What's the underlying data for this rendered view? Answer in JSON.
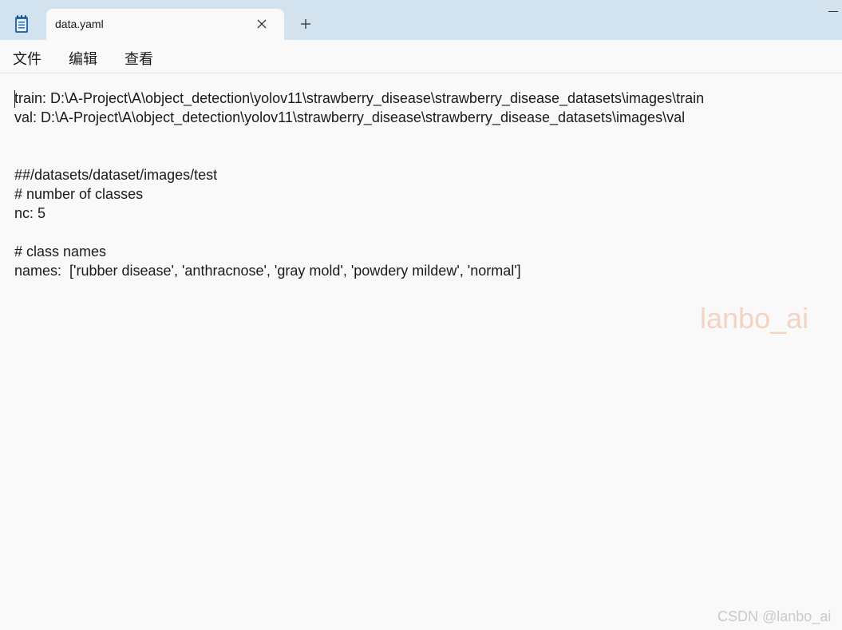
{
  "tab": {
    "title": "data.yaml"
  },
  "menu": {
    "file": "文件",
    "edit": "编辑",
    "view": "查看"
  },
  "editor": {
    "lines": [
      "train: D:\\A-Project\\A\\object_detection\\yolov11\\strawberry_disease\\strawberry_disease_datasets\\images\\train",
      "val: D:\\A-Project\\A\\object_detection\\yolov11\\strawberry_disease\\strawberry_disease_datasets\\images\\val",
      "",
      "",
      "##/datasets/dataset/images/test",
      "# number of classes",
      "nc: 5",
      "",
      "# class names",
      "names:  ['rubber disease', 'anthracnose', 'gray mold', 'powdery mildew', 'normal']"
    ]
  },
  "watermarks": {
    "overlay": "lanbo_ai",
    "footer": "CSDN @lanbo_ai"
  },
  "icons": {
    "app": "notepad-icon",
    "close": "close-icon",
    "add": "plus-icon",
    "minimize": "minimize-icon"
  },
  "colors": {
    "tabbar": "#d3e2ef",
    "background": "#f9f9f9",
    "accent": "#2b6cb0"
  }
}
